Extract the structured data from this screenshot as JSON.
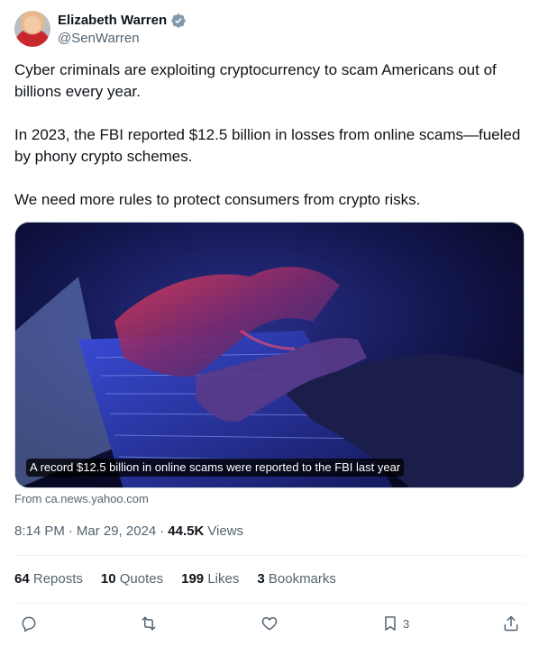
{
  "author": {
    "display_name": "Elizabeth Warren",
    "handle": "@SenWarren",
    "verified": true
  },
  "tweet": {
    "paragraphs": [
      "Cyber criminals are exploiting cryptocurrency to scam Americans out of billions every year.",
      "In 2023, the FBI reported $12.5 billion in losses from online scams—fueled by phony crypto schemes.",
      "We need more rules to protect consumers from crypto risks."
    ]
  },
  "card": {
    "caption": "A record $12.5 billion in online scams were reported to the FBI last year",
    "source": "From ca.news.yahoo.com"
  },
  "meta": {
    "time": "8:14 PM",
    "separator": "·",
    "date": "Mar 29, 2024",
    "views_count": "44.5K",
    "views_label": "Views"
  },
  "stats": {
    "reposts": {
      "count": "64",
      "label": "Reposts"
    },
    "quotes": {
      "count": "10",
      "label": "Quotes"
    },
    "likes": {
      "count": "199",
      "label": "Likes"
    },
    "bookmarks": {
      "count": "3",
      "label": "Bookmarks"
    }
  },
  "actions": {
    "bookmark_count": "3"
  },
  "colors": {
    "text_primary": "#0f1419",
    "text_secondary": "#536471",
    "verified_blue": "#829aab",
    "divider": "#eff3f4"
  }
}
